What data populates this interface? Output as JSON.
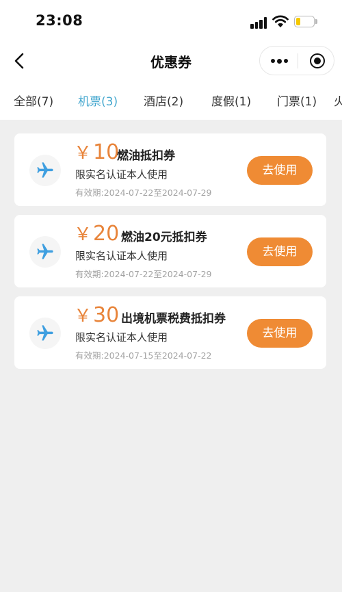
{
  "status_bar": {
    "time": "23:08"
  },
  "nav": {
    "title": "优惠券"
  },
  "tabs": [
    {
      "label": "全部(7)",
      "active": false
    },
    {
      "label": "机票(3)",
      "active": true
    },
    {
      "label": "酒店(2)",
      "active": false
    },
    {
      "label": "度假(1)",
      "active": false
    },
    {
      "label": "门票(1)",
      "active": false
    },
    {
      "label": "火",
      "active": false
    }
  ],
  "coupons": [
    {
      "currency": "￥",
      "amount": "10",
      "title": "燃油抵扣券",
      "desc": "限实名认证本人使用",
      "validity": "有效期:2024-07-22至2024-07-29",
      "button": "去使用"
    },
    {
      "currency": "￥",
      "amount": "20",
      "title": "燃油20元抵扣券",
      "desc": "限实名认证本人使用",
      "validity": "有效期:2024-07-22至2024-07-29",
      "button": "去使用"
    },
    {
      "currency": "￥",
      "amount": "30",
      "title": "出境机票税费抵扣券",
      "desc": "限实名认证本人使用",
      "validity": "有效期:2024-07-15至2024-07-22",
      "button": "去使用"
    }
  ],
  "icons": {
    "plane": "airplane-icon",
    "back": "chevron-left-icon",
    "more": "more-dots-icon",
    "close": "target-circle-icon"
  },
  "colors": {
    "accent_tab": "#46a8cf",
    "amount": "#e8843a",
    "button": "#ef8b34",
    "plane": "#3f9fe0",
    "background": "#efefef",
    "battery": "#f5c800"
  }
}
